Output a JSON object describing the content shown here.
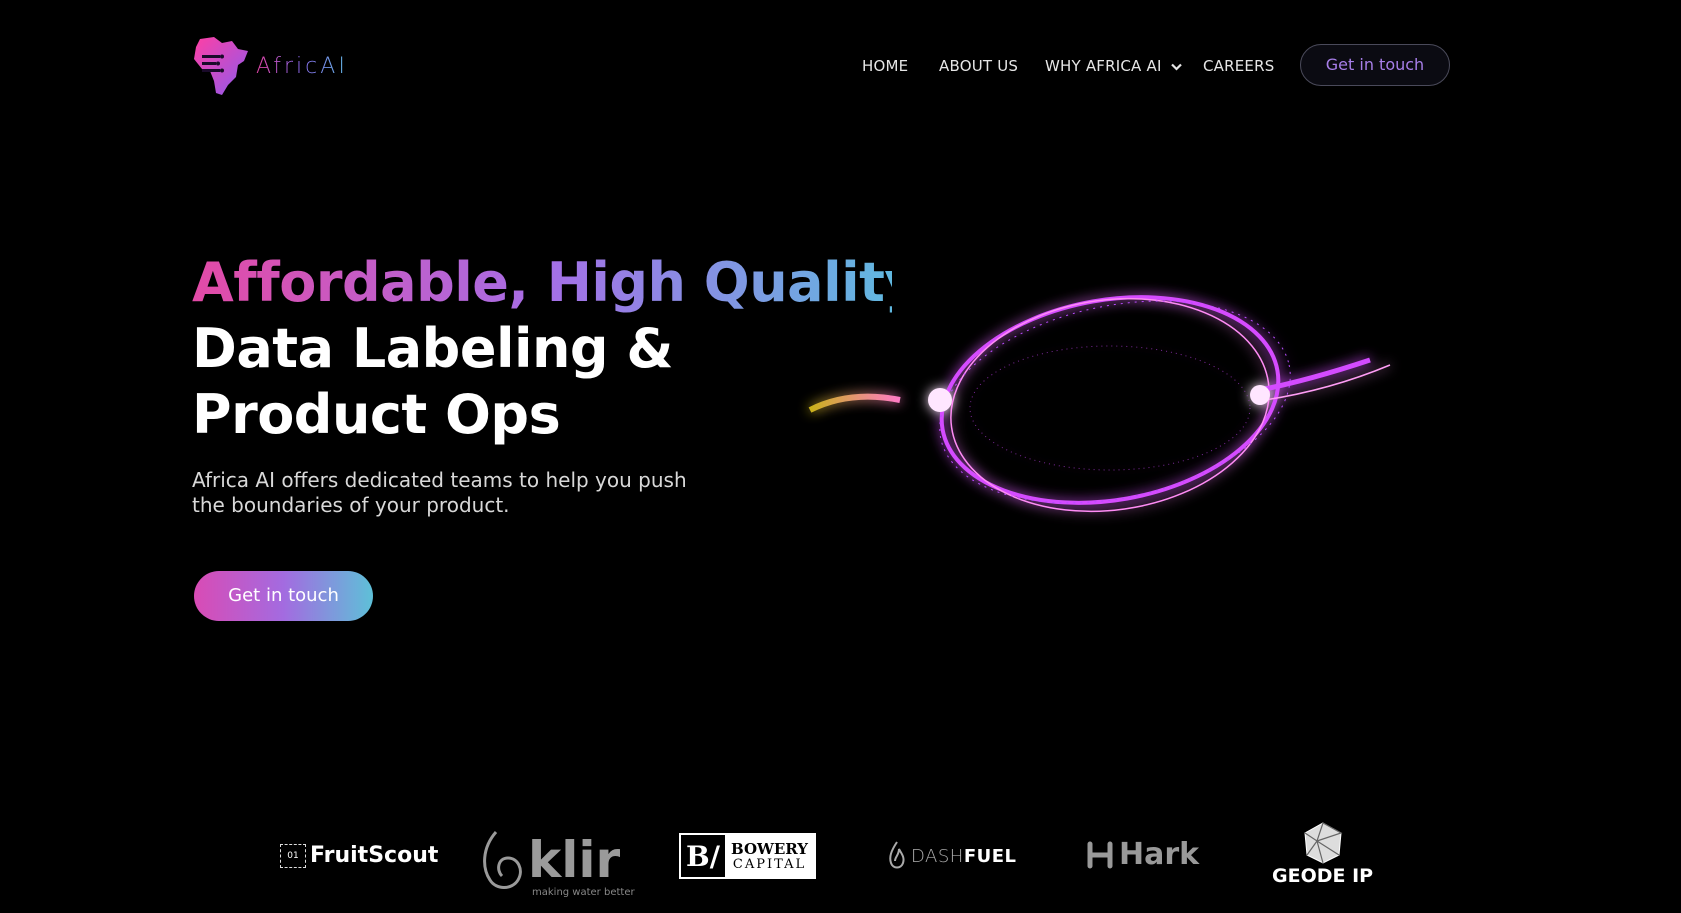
{
  "header": {
    "logo_text": "AfricAI",
    "nav": [
      {
        "label": "HOME"
      },
      {
        "label": "ABOUT US"
      },
      {
        "label": "WHY AFRICA AI"
      },
      {
        "label": "CAREERS"
      }
    ],
    "cta_label": "Get in touch"
  },
  "hero": {
    "title_line_1": "Affordable, High Quality",
    "title_line_2": "Data Labeling &",
    "title_line_3": "Product Ops",
    "subtitle_line_1": "Africa AI offers dedicated teams to help you push",
    "subtitle_line_2": "the boundaries of your product.",
    "cta_label": "Get in touch"
  },
  "clients": {
    "fruitscout": {
      "label": "FruitScout",
      "badge": "01"
    },
    "klir": {
      "label": "klir",
      "tagline": "making water better"
    },
    "bowery": {
      "mark": "B/",
      "line_1": "BOWERY",
      "line_2": "CAPITAL"
    },
    "dashfuel": {
      "part_1": "DASH",
      "part_2": "FUEL"
    },
    "hark": {
      "label": "Hark"
    },
    "geode": {
      "label": "GEODE IP"
    }
  },
  "colors": {
    "background": "#000000",
    "gradient_pink": "#e34aa6",
    "gradient_purple": "#a66ee6",
    "gradient_cyan": "#61b8e0"
  }
}
